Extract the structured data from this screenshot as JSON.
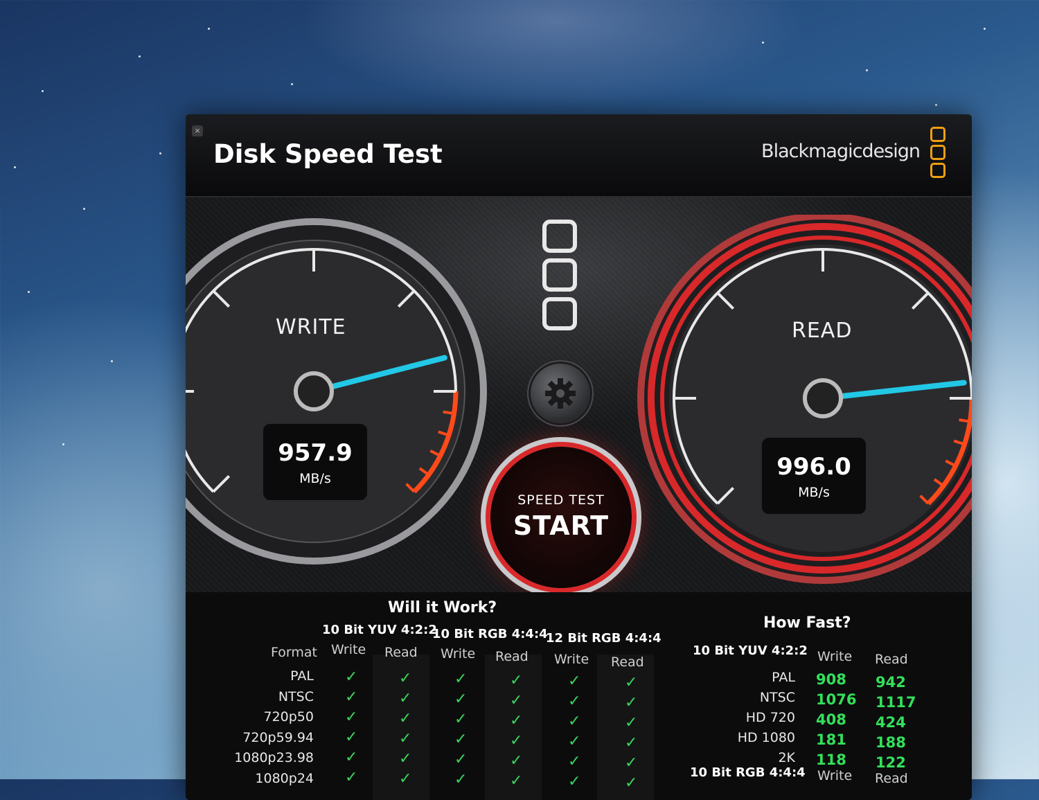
{
  "window": {
    "title": "Disk Speed Test",
    "close_label": "×",
    "brand": "Blackmagicdesign"
  },
  "write_gauge": {
    "label": "WRITE",
    "value": "957.9",
    "unit": "MB/s",
    "needle_fraction": 0.78
  },
  "read_gauge": {
    "label": "READ",
    "value": "996.0",
    "unit": "MB/s",
    "needle_fraction": 0.81
  },
  "start_button": {
    "top": "SPEED TEST",
    "main": "START"
  },
  "will_it_work": {
    "title": "Will it Work?",
    "format_header": "Format",
    "groups": [
      "10 Bit YUV 4:2:2",
      "10 Bit RGB 4:4:4",
      "12 Bit RGB 4:4:4"
    ],
    "sub_write": "Write",
    "sub_read": "Read",
    "rows": [
      "PAL",
      "NTSC",
      "720p50",
      "720p59.94",
      "1080p23.98",
      "1080p24"
    ],
    "check_symbol": "✓"
  },
  "how_fast": {
    "title": "How Fast?",
    "group": "10 Bit YUV 4:2:2",
    "col_write": "Write",
    "col_read": "Read",
    "rows": [
      {
        "format": "PAL",
        "write": "908",
        "read": "942"
      },
      {
        "format": "NTSC",
        "write": "1076",
        "read": "1117"
      },
      {
        "format": "HD 720",
        "write": "408",
        "read": "424"
      },
      {
        "format": "HD 1080",
        "write": "181",
        "read": "188"
      },
      {
        "format": "2K",
        "write": "118",
        "read": "122"
      }
    ],
    "next_group": "10 Bit RGB 4:4:4",
    "next_write": "Write",
    "next_read": "Read"
  },
  "colors": {
    "accent_red": "#d9282a",
    "needle": "#22c8e6",
    "ok_green": "#33e05a",
    "logo_orange": "#f0a010"
  }
}
